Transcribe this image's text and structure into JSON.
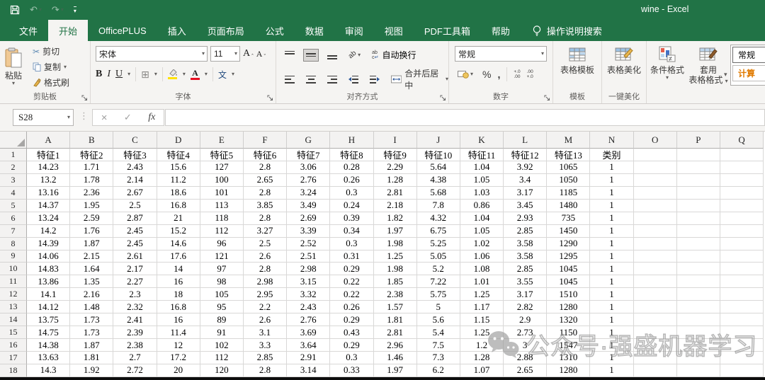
{
  "title_bar": {
    "title": "wine  -  Excel"
  },
  "tabs": [
    {
      "id": "file",
      "label": "文件"
    },
    {
      "id": "home",
      "label": "开始",
      "active": true
    },
    {
      "id": "officeplus",
      "label": "OfficePLUS"
    },
    {
      "id": "insert",
      "label": "插入"
    },
    {
      "id": "page-layout",
      "label": "页面布局"
    },
    {
      "id": "formulas",
      "label": "公式"
    },
    {
      "id": "data",
      "label": "数据"
    },
    {
      "id": "review",
      "label": "审阅"
    },
    {
      "id": "view",
      "label": "视图"
    },
    {
      "id": "pdf-toolbox",
      "label": "PDF工具箱"
    },
    {
      "id": "help",
      "label": "帮助"
    }
  ],
  "search_label": "操作说明搜索",
  "ribbon": {
    "clipboard": {
      "group_label": "剪贴板",
      "paste": "粘贴",
      "cut": "剪切",
      "copy": "复制",
      "format_painter": "格式刷"
    },
    "font": {
      "group_label": "字体",
      "font_name": "宋体",
      "font_size": "11",
      "bold": "B",
      "italic": "I",
      "underline": "U",
      "phonetic": "文"
    },
    "alignment": {
      "group_label": "对齐方式",
      "wrap_text": "自动换行",
      "merge_center": "合并后居中"
    },
    "number": {
      "group_label": "数字",
      "format": "常规"
    },
    "template": {
      "group_label": "模板",
      "button": "表格模板"
    },
    "beautify": {
      "group_label": "一键美化",
      "button": "表格美化"
    },
    "styles": {
      "conditional": "条件格式",
      "format_as_table_line1": "套用",
      "format_as_table_line2": "表格格式",
      "gallery": [
        "常规",
        "计算"
      ]
    }
  },
  "formula_bar": {
    "name_box": "S28",
    "formula": ""
  },
  "icons": {
    "dropdown": "▾",
    "undo": "↶",
    "redo": "↷",
    "scissors": "✂",
    "borders": "⊞",
    "close": "×",
    "check": "✓",
    "fx": "fx",
    "percent": "%",
    "comma": ",",
    "ellipsis_v": "⋮",
    "caret_up": "ˆ",
    "caret_down": "ˇ",
    "font_letter": "A",
    "orientation": "ab",
    "wrap_l1": "ab",
    "wrap_l2": "c",
    "return_arrow": "↵",
    "inc_decimal_l1": "+.0",
    "inc_decimal_l2": ".00",
    "dec_decimal_l1": ".00",
    "dec_decimal_l2": "+.0"
  },
  "grid": {
    "column_letters": [
      "A",
      "B",
      "C",
      "D",
      "E",
      "F",
      "G",
      "H",
      "I",
      "J",
      "K",
      "L",
      "M",
      "N",
      "O",
      "P",
      "Q"
    ],
    "header_row": [
      "特征1",
      "特征2",
      "特征3",
      "特征4",
      "特征5",
      "特征6",
      "特征7",
      "特征8",
      "特征9",
      "特征10",
      "特征11",
      "特征12",
      "特征13",
      "类别"
    ],
    "rows": [
      [
        "14.23",
        "1.71",
        "2.43",
        "15.6",
        "127",
        "2.8",
        "3.06",
        "0.28",
        "2.29",
        "5.64",
        "1.04",
        "3.92",
        "1065",
        "1"
      ],
      [
        "13.2",
        "1.78",
        "2.14",
        "11.2",
        "100",
        "2.65",
        "2.76",
        "0.26",
        "1.28",
        "4.38",
        "1.05",
        "3.4",
        "1050",
        "1"
      ],
      [
        "13.16",
        "2.36",
        "2.67",
        "18.6",
        "101",
        "2.8",
        "3.24",
        "0.3",
        "2.81",
        "5.68",
        "1.03",
        "3.17",
        "1185",
        "1"
      ],
      [
        "14.37",
        "1.95",
        "2.5",
        "16.8",
        "113",
        "3.85",
        "3.49",
        "0.24",
        "2.18",
        "7.8",
        "0.86",
        "3.45",
        "1480",
        "1"
      ],
      [
        "13.24",
        "2.59",
        "2.87",
        "21",
        "118",
        "2.8",
        "2.69",
        "0.39",
        "1.82",
        "4.32",
        "1.04",
        "2.93",
        "735",
        "1"
      ],
      [
        "14.2",
        "1.76",
        "2.45",
        "15.2",
        "112",
        "3.27",
        "3.39",
        "0.34",
        "1.97",
        "6.75",
        "1.05",
        "2.85",
        "1450",
        "1"
      ],
      [
        "14.39",
        "1.87",
        "2.45",
        "14.6",
        "96",
        "2.5",
        "2.52",
        "0.3",
        "1.98",
        "5.25",
        "1.02",
        "3.58",
        "1290",
        "1"
      ],
      [
        "14.06",
        "2.15",
        "2.61",
        "17.6",
        "121",
        "2.6",
        "2.51",
        "0.31",
        "1.25",
        "5.05",
        "1.06",
        "3.58",
        "1295",
        "1"
      ],
      [
        "14.83",
        "1.64",
        "2.17",
        "14",
        "97",
        "2.8",
        "2.98",
        "0.29",
        "1.98",
        "5.2",
        "1.08",
        "2.85",
        "1045",
        "1"
      ],
      [
        "13.86",
        "1.35",
        "2.27",
        "16",
        "98",
        "2.98",
        "3.15",
        "0.22",
        "1.85",
        "7.22",
        "1.01",
        "3.55",
        "1045",
        "1"
      ],
      [
        "14.1",
        "2.16",
        "2.3",
        "18",
        "105",
        "2.95",
        "3.32",
        "0.22",
        "2.38",
        "5.75",
        "1.25",
        "3.17",
        "1510",
        "1"
      ],
      [
        "14.12",
        "1.48",
        "2.32",
        "16.8",
        "95",
        "2.2",
        "2.43",
        "0.26",
        "1.57",
        "5",
        "1.17",
        "2.82",
        "1280",
        "1"
      ],
      [
        "13.75",
        "1.73",
        "2.41",
        "16",
        "89",
        "2.6",
        "2.76",
        "0.29",
        "1.81",
        "5.6",
        "1.15",
        "2.9",
        "1320",
        "1"
      ],
      [
        "14.75",
        "1.73",
        "2.39",
        "11.4",
        "91",
        "3.1",
        "3.69",
        "0.43",
        "2.81",
        "5.4",
        "1.25",
        "2.73",
        "1150",
        "1"
      ],
      [
        "14.38",
        "1.87",
        "2.38",
        "12",
        "102",
        "3.3",
        "3.64",
        "0.29",
        "2.96",
        "7.5",
        "1.2",
        "3",
        "1547",
        "1"
      ],
      [
        "13.63",
        "1.81",
        "2.7",
        "17.2",
        "112",
        "2.85",
        "2.91",
        "0.3",
        "1.46",
        "7.3",
        "1.28",
        "2.88",
        "1310",
        "1"
      ],
      [
        "14.3",
        "1.92",
        "2.72",
        "20",
        "120",
        "2.8",
        "3.14",
        "0.33",
        "1.97",
        "6.2",
        "1.07",
        "2.65",
        "1280",
        "1"
      ]
    ],
    "visible_row_count": 18
  },
  "watermark": {
    "text": "公众号·强盛机器学习"
  },
  "colors": {
    "title_green": "#217346",
    "fill_yellow": "#ffe100",
    "font_red": "#e81123",
    "calc_orange": "#e07a00"
  }
}
